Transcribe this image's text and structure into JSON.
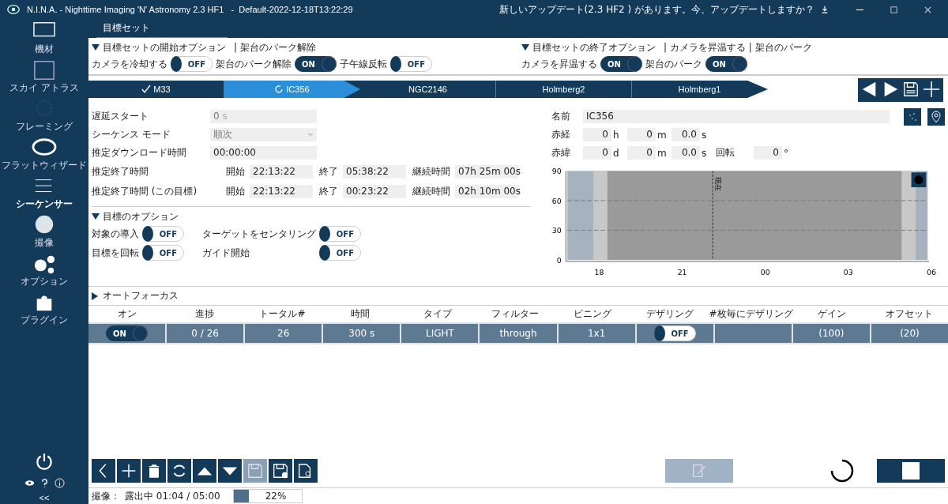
{
  "window": {
    "title": "N.I.N.A. - Nighttime Imaging 'N' Astronomy 2.3 HF1   -  Default-2022-12-18T13:22:29",
    "update_notice": "新しいアップデート(2.3 HF2 ) があります。今、アップデートしますか？"
  },
  "sidebar": {
    "items": [
      {
        "label": "機材",
        "selected": false
      },
      {
        "label": "スカイ アトラス",
        "selected": false
      },
      {
        "label": "フレーミング",
        "selected": false
      },
      {
        "label": "フラットウィザード",
        "selected": false
      },
      {
        "label": "シーケンサー",
        "selected": true
      },
      {
        "label": "撮像",
        "selected": false
      },
      {
        "label": "オプション",
        "selected": false
      },
      {
        "label": "プラグイン",
        "selected": false
      }
    ],
    "collapse": "<<"
  },
  "page_tab": "目標セット",
  "start_options": {
    "header": "目標セットの開始オプション",
    "summary": "| 架台のパーク解除",
    "toggles": [
      {
        "label": "カメラを冷却する",
        "on": false,
        "text": "OFF"
      },
      {
        "label": "架台のパーク解除",
        "on": true,
        "text": "ON"
      },
      {
        "label": "子午線反転",
        "on": false,
        "text": "OFF"
      }
    ]
  },
  "end_options": {
    "header": "目標セットの終了オプション",
    "summary": "| カメラを昇温する | 架台のパーク",
    "toggles": [
      {
        "label": "カメラを昇温する",
        "on": true,
        "text": "ON"
      },
      {
        "label": "架台のパーク",
        "on": true,
        "text": "ON"
      }
    ]
  },
  "targets": [
    {
      "name": "M33",
      "completed": true,
      "selected": false
    },
    {
      "name": "IC356",
      "completed": false,
      "selected": true
    },
    {
      "name": "NGC2146",
      "completed": false,
      "selected": false
    },
    {
      "name": "Holmberg2",
      "completed": false,
      "selected": false
    },
    {
      "name": "Holmberg1",
      "completed": false,
      "selected": false
    }
  ],
  "details": {
    "delay_label": "遅延スタート",
    "delay_value": "0",
    "delay_unit": "s",
    "mode_label": "シーケンス モード",
    "mode_value": "順次",
    "download_label": "推定ダウンロード時間",
    "download_value": "00:00:00",
    "estimates": [
      {
        "label": "推定終了時間",
        "start_label": "開始",
        "start": "22:13:22",
        "end_label": "終了",
        "end": "05:38:22",
        "duration_label": "継続時間",
        "duration": "07h 25m 00s"
      },
      {
        "label": "推定終了時間 (この目標)",
        "start_label": "開始",
        "start": "22:13:22",
        "end_label": "終了",
        "end": "00:23:22",
        "duration_label": "継続時間",
        "duration": "02h 10m 00s"
      }
    ]
  },
  "coordinates": {
    "name_label": "名前",
    "name": "IC356",
    "ra_label": "赤経",
    "ra": [
      {
        "value": "0",
        "unit": "h"
      },
      {
        "value": "0",
        "unit": "m"
      },
      {
        "value": "0.0",
        "unit": "s"
      }
    ],
    "dec_label": "赤緯",
    "dec": [
      {
        "value": "0",
        "unit": "d"
      },
      {
        "value": "0",
        "unit": "m"
      },
      {
        "value": "0.0",
        "unit": "s"
      }
    ],
    "rotation_label": "回転",
    "rotation": "0",
    "rotation_unit": "°"
  },
  "altitude_chart": {
    "y_labels": [
      "90",
      "60",
      "30",
      "0"
    ],
    "x_labels": [
      "18",
      "21",
      "00",
      "03",
      "06"
    ],
    "now_label": "現在"
  },
  "target_options": {
    "header": "目標のオプション",
    "toggles": [
      {
        "label": "対象の導入",
        "on": false,
        "text": "OFF"
      },
      {
        "label": "ターゲットをセンタリング",
        "on": false,
        "text": "OFF"
      },
      {
        "label": "目標を回転",
        "on": false,
        "text": "OFF"
      },
      {
        "label": "ガイド開始",
        "on": false,
        "text": "OFF"
      }
    ]
  },
  "autofocus": {
    "header": "オートフォーカス"
  },
  "table": {
    "columns": [
      "オン",
      "進捗",
      "トータル#",
      "時間",
      "タイプ",
      "フィルター",
      "ビニング",
      "デザリング",
      "#枚毎にデザリング",
      "ゲイン",
      "オフセット"
    ],
    "rows": [
      {
        "on": true,
        "on_text": "ON",
        "progress": "0 / 26",
        "total": "26",
        "time": "300 s",
        "type": "LIGHT",
        "filter": "through",
        "binning": "1x1",
        "dither": false,
        "dither_text": "OFF",
        "dither_every": "",
        "gain": "(100)",
        "offset": "(20)"
      }
    ]
  },
  "status_bar": {
    "label": "撮像：",
    "exposure": "露出中 01:04 / 05:00",
    "level": 0.22,
    "percent": "22%"
  }
}
